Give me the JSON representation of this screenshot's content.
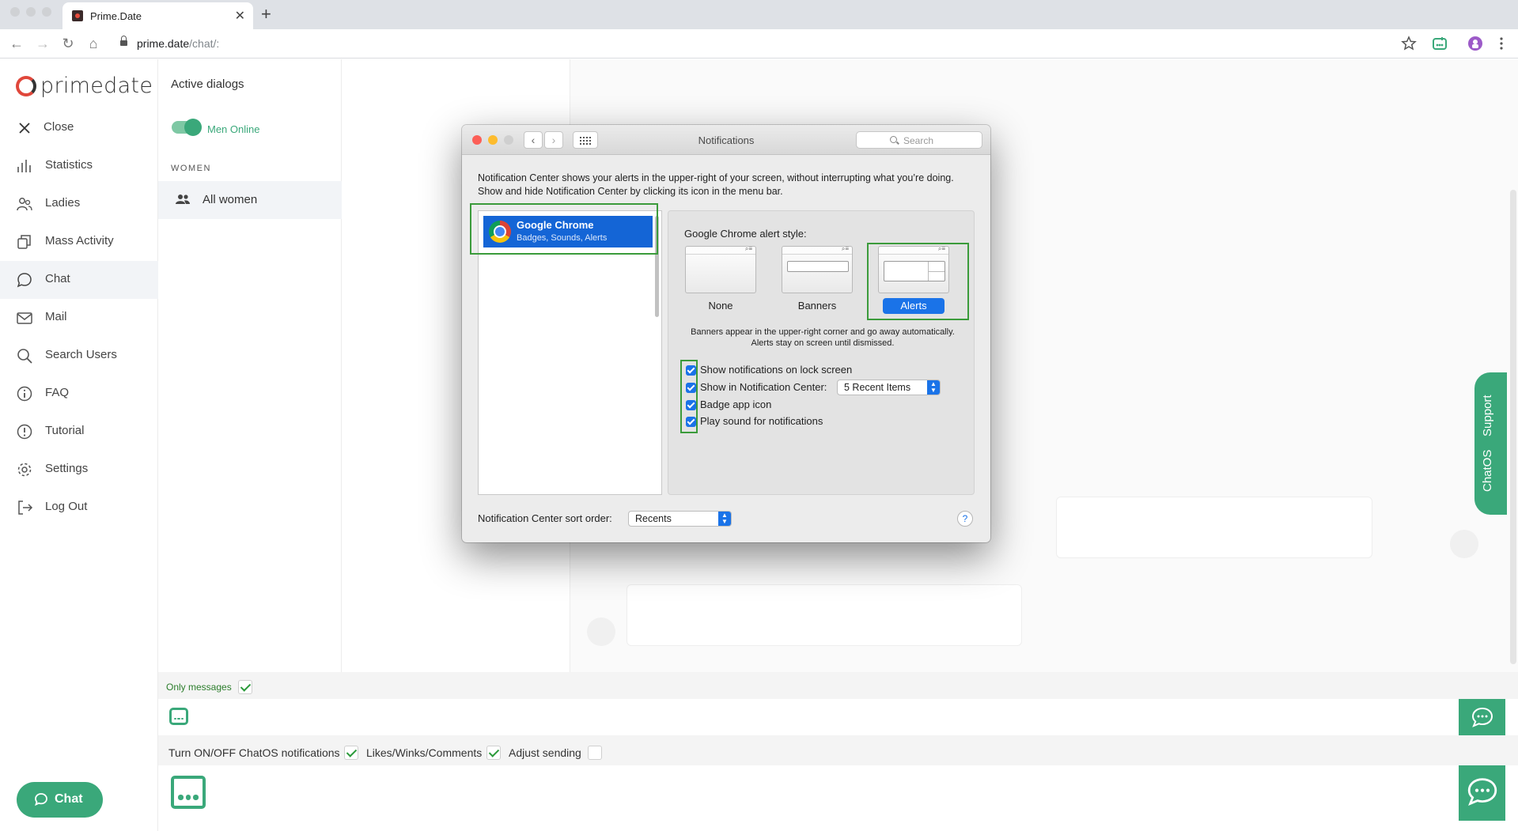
{
  "browser": {
    "tab_title": "Prime.Date",
    "url_host": "prime.date",
    "url_path": "/chat/:"
  },
  "sidebar": {
    "logo": "primedate",
    "items": [
      {
        "label": "Close",
        "icon": "close-icon"
      },
      {
        "label": "Statistics",
        "icon": "bar-chart-icon"
      },
      {
        "label": "Ladies",
        "icon": "users-icon"
      },
      {
        "label": "Mass Activity",
        "icon": "copy-icon"
      },
      {
        "label": "Chat",
        "icon": "chat-bubble-icon"
      },
      {
        "label": "Mail",
        "icon": "mail-icon"
      },
      {
        "label": "Search Users",
        "icon": "search-icon"
      },
      {
        "label": "FAQ",
        "icon": "info-icon"
      },
      {
        "label": "Tutorial",
        "icon": "help-circle-icon"
      },
      {
        "label": "Settings",
        "icon": "gear-icon"
      },
      {
        "label": "Log Out",
        "icon": "logout-icon"
      }
    ],
    "active_item": "Chat",
    "chat_button": "Chat"
  },
  "dialogs": {
    "title": "Active dialogs",
    "toggle_label": "Men Online",
    "toggle_on": true,
    "section": "WOMEN",
    "all_women": "All women"
  },
  "support_tab": {
    "label_1": "Support",
    "label_2": "ChatOS"
  },
  "bottom": {
    "only_messages": "Only messages",
    "only_messages_checked": true,
    "turn_on_off": "Turn ON/OFF ChatOS notifications",
    "turn_on_off_checked": true,
    "likes": "Likes/Winks/Comments",
    "likes_checked": true,
    "adjust": "Adjust sending",
    "adjust_checked": false
  },
  "notifications_window": {
    "title": "Notifications",
    "search_placeholder": "Search",
    "description": "Notification Center shows your alerts in the upper-right of your screen, without interrupting what you’re doing. Show and hide Notification Center by clicking its icon in the menu bar.",
    "app": {
      "name": "Google Chrome",
      "subtitle": "Badges, Sounds, Alerts"
    },
    "alert_style_title": "Google Chrome alert style:",
    "styles": [
      "None",
      "Banners",
      "Alerts"
    ],
    "selected_style": "Alerts",
    "style_note": "Banners appear in the upper-right corner and go away automatically. Alerts stay on screen until dismissed.",
    "options": [
      {
        "label": "Show notifications on lock screen",
        "checked": true
      },
      {
        "label": "Show in Notification Center:",
        "checked": true
      },
      {
        "label": "Badge app icon",
        "checked": true
      },
      {
        "label": "Play sound for notifications",
        "checked": true
      }
    ],
    "recent_items": "5 Recent Items",
    "sort_label": "Notification Center sort order:",
    "sort_value": "Recents",
    "help": "?"
  },
  "colors": {
    "brand_green": "#3aa87a",
    "annotation_green": "#3b9b3b",
    "mac_blue": "#1a73e8",
    "logo_red": "#e0473b"
  }
}
